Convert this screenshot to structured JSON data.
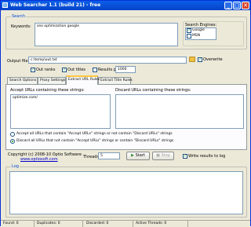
{
  "window": {
    "title": "Web Searcher 1.1 (build 21) - free",
    "minimize": "_",
    "maximize": "□",
    "close": "✕"
  },
  "search": {
    "group_label": "Search",
    "keywords_label": "Keywords:",
    "keywords_value": "seo optimization google",
    "engines_label": "Search Engines:",
    "engines": [
      {
        "label": "Google",
        "checked": true
      },
      {
        "label": "MSN",
        "checked": false
      }
    ]
  },
  "output": {
    "file_label": "Output file:",
    "file_value": "c:\\temp\\out.txt",
    "overwrite_label": "Overwrite",
    "out_ranks_label": "Out ranks",
    "out_titles_label": "Out titles",
    "results_per_file_label": "Results per file",
    "results_per_file_value": "1000"
  },
  "tabs": [
    {
      "label": "Search Options"
    },
    {
      "label": "Proxy Settings"
    },
    {
      "label": "Extract URL Rules"
    },
    {
      "label": "Extract Title Rules"
    }
  ],
  "rules": {
    "accept_label": "Accept URLs containing these strings:",
    "accept_value": "optimize.com/",
    "discard_label": "Discard URLs containing these strings:",
    "discard_value": "",
    "mode1_label": "Accept all URLs that contain \"Accept URLs\" strings or not contain \"Discard URLs\" strings",
    "mode2_label": "Discard all URLs that not contain \"Accept URLs\" strings or contain \"Discard URLs\" strings"
  },
  "footer": {
    "copyright": "Copyright (c) 2008-10 Optio Software",
    "website": "www.optiosoft.com",
    "threads_label": "Threads:",
    "threads_value": "5",
    "start_label": "Start",
    "stop_label": "Stop",
    "write_log_label": "Write results to log"
  },
  "log": {
    "group_label": "Log"
  },
  "status": {
    "found": "Found: 0",
    "duplicates": "Duplicates: 0",
    "discarded": "Discarded: 0",
    "active_threads": "Active Threads: 0"
  }
}
